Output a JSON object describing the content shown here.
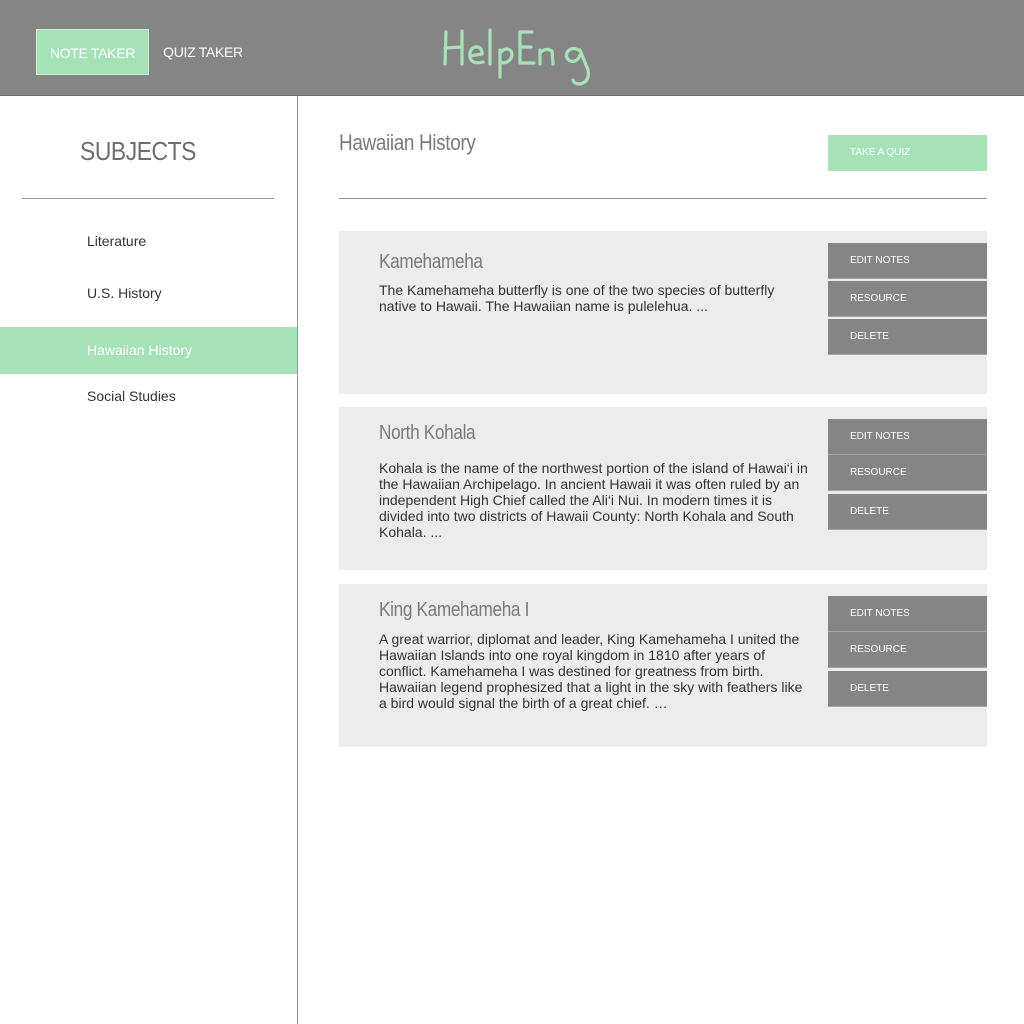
{
  "header": {
    "tabs": [
      {
        "label": "NOTE TAKER",
        "active": true
      },
      {
        "label": "QUIZ TAKER",
        "active": false
      }
    ],
    "logo_text": "HelpEng",
    "logo_color": "#a6e2b8"
  },
  "sidebar": {
    "title": "SUBJECTS",
    "subjects": [
      {
        "label": "Literature",
        "active": false
      },
      {
        "label": "U.S. History",
        "active": false
      },
      {
        "label": "Hawaiian History",
        "active": true
      },
      {
        "label": "Social Studies",
        "active": false
      }
    ]
  },
  "main": {
    "title": "Hawaiian History",
    "quiz_button": "TAKE A QUIZ",
    "notes": [
      {
        "title": "Kamehameha",
        "body": "The Kamehameha butterfly is one of the two species of butterfly native to Hawaii. The Hawaiian name is pulelehua. ...",
        "edit_label": "EDIT NOTES",
        "resource_label": "RESOURCE",
        "delete_label": "DELETE"
      },
      {
        "title": "North Kohala",
        "body": "Kohala is the name of the northwest portion of the island of Hawai‘i in the Hawaiian Archipelago. In ancient Hawaii it was often ruled by an independent High Chief called the Ali‘i Nui. In modern times it is divided into two districts of Hawaii County: North Kohala and  South Kohala. ...",
        "edit_label": "EDIT NOTES",
        "resource_label": "RESOURCE",
        "delete_label": "DELETE"
      },
      {
        "title": "King Kamehameha I",
        "body": "A great warrior, diplomat and leader, King Kamehameha I united the Hawaiian Islands into one royal kingdom in 1810 after years of conflict. Kamehameha I was destined for greatness from birth. Hawaiian legend prophesized that a light in the sky with feathers like a bird would signal the birth of a great chief. …",
        "edit_label": "EDIT NOTES",
        "resource_label": "RESOURCE",
        "delete_label": "DELETE"
      }
    ]
  },
  "colors": {
    "accent": "#a6e2b8",
    "header_bg": "#858585",
    "card_bg": "#ececec"
  }
}
